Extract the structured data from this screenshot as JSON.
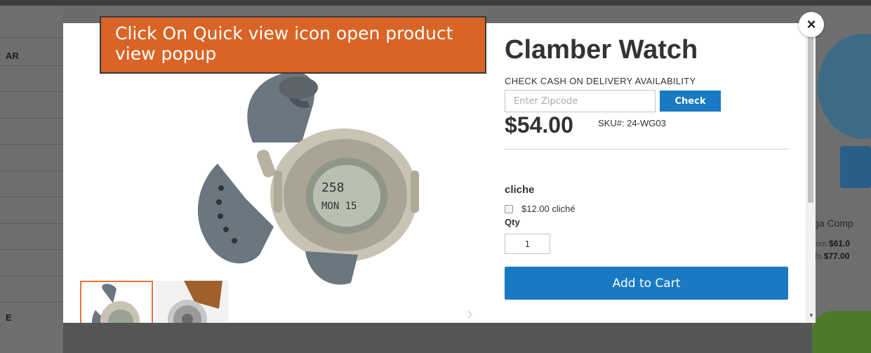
{
  "background": {
    "sidebar_labels": [
      "AR",
      "E"
    ],
    "product_name": "ga Comp",
    "price_from_label": "rom",
    "price_from_value": "$61.0",
    "price_to_label": "To",
    "price_to_value": "$77.00"
  },
  "annotation": {
    "callout_text": "Click On Quick view icon open product view popup"
  },
  "modal": {
    "close_icon": "×",
    "gallery": {
      "main_image": "watch-gray-image",
      "thumbnails": [
        "watch-gray-thumb",
        "watch-brown-thumb"
      ],
      "next_arrow": "›"
    },
    "product": {
      "title": "Clamber Watch",
      "cod_label": "CHECK CASH ON DELIVERY AVAILABILITY",
      "zip_placeholder": "Enter Zipcode",
      "zip_value": "",
      "check_label": "Check",
      "price": "$54.00",
      "sku": "SKU#:  24-WG03",
      "option_title": "cliche",
      "option_label": "$12.00 cliché",
      "option_checked": false,
      "qty_label": "Qty",
      "qty_value": "1",
      "add_to_cart_label": "Add to Cart"
    }
  },
  "colors": {
    "accent_blue": "#1979c3",
    "callout_orange": "#d96426",
    "thumb_active_border": "#e2753b"
  }
}
